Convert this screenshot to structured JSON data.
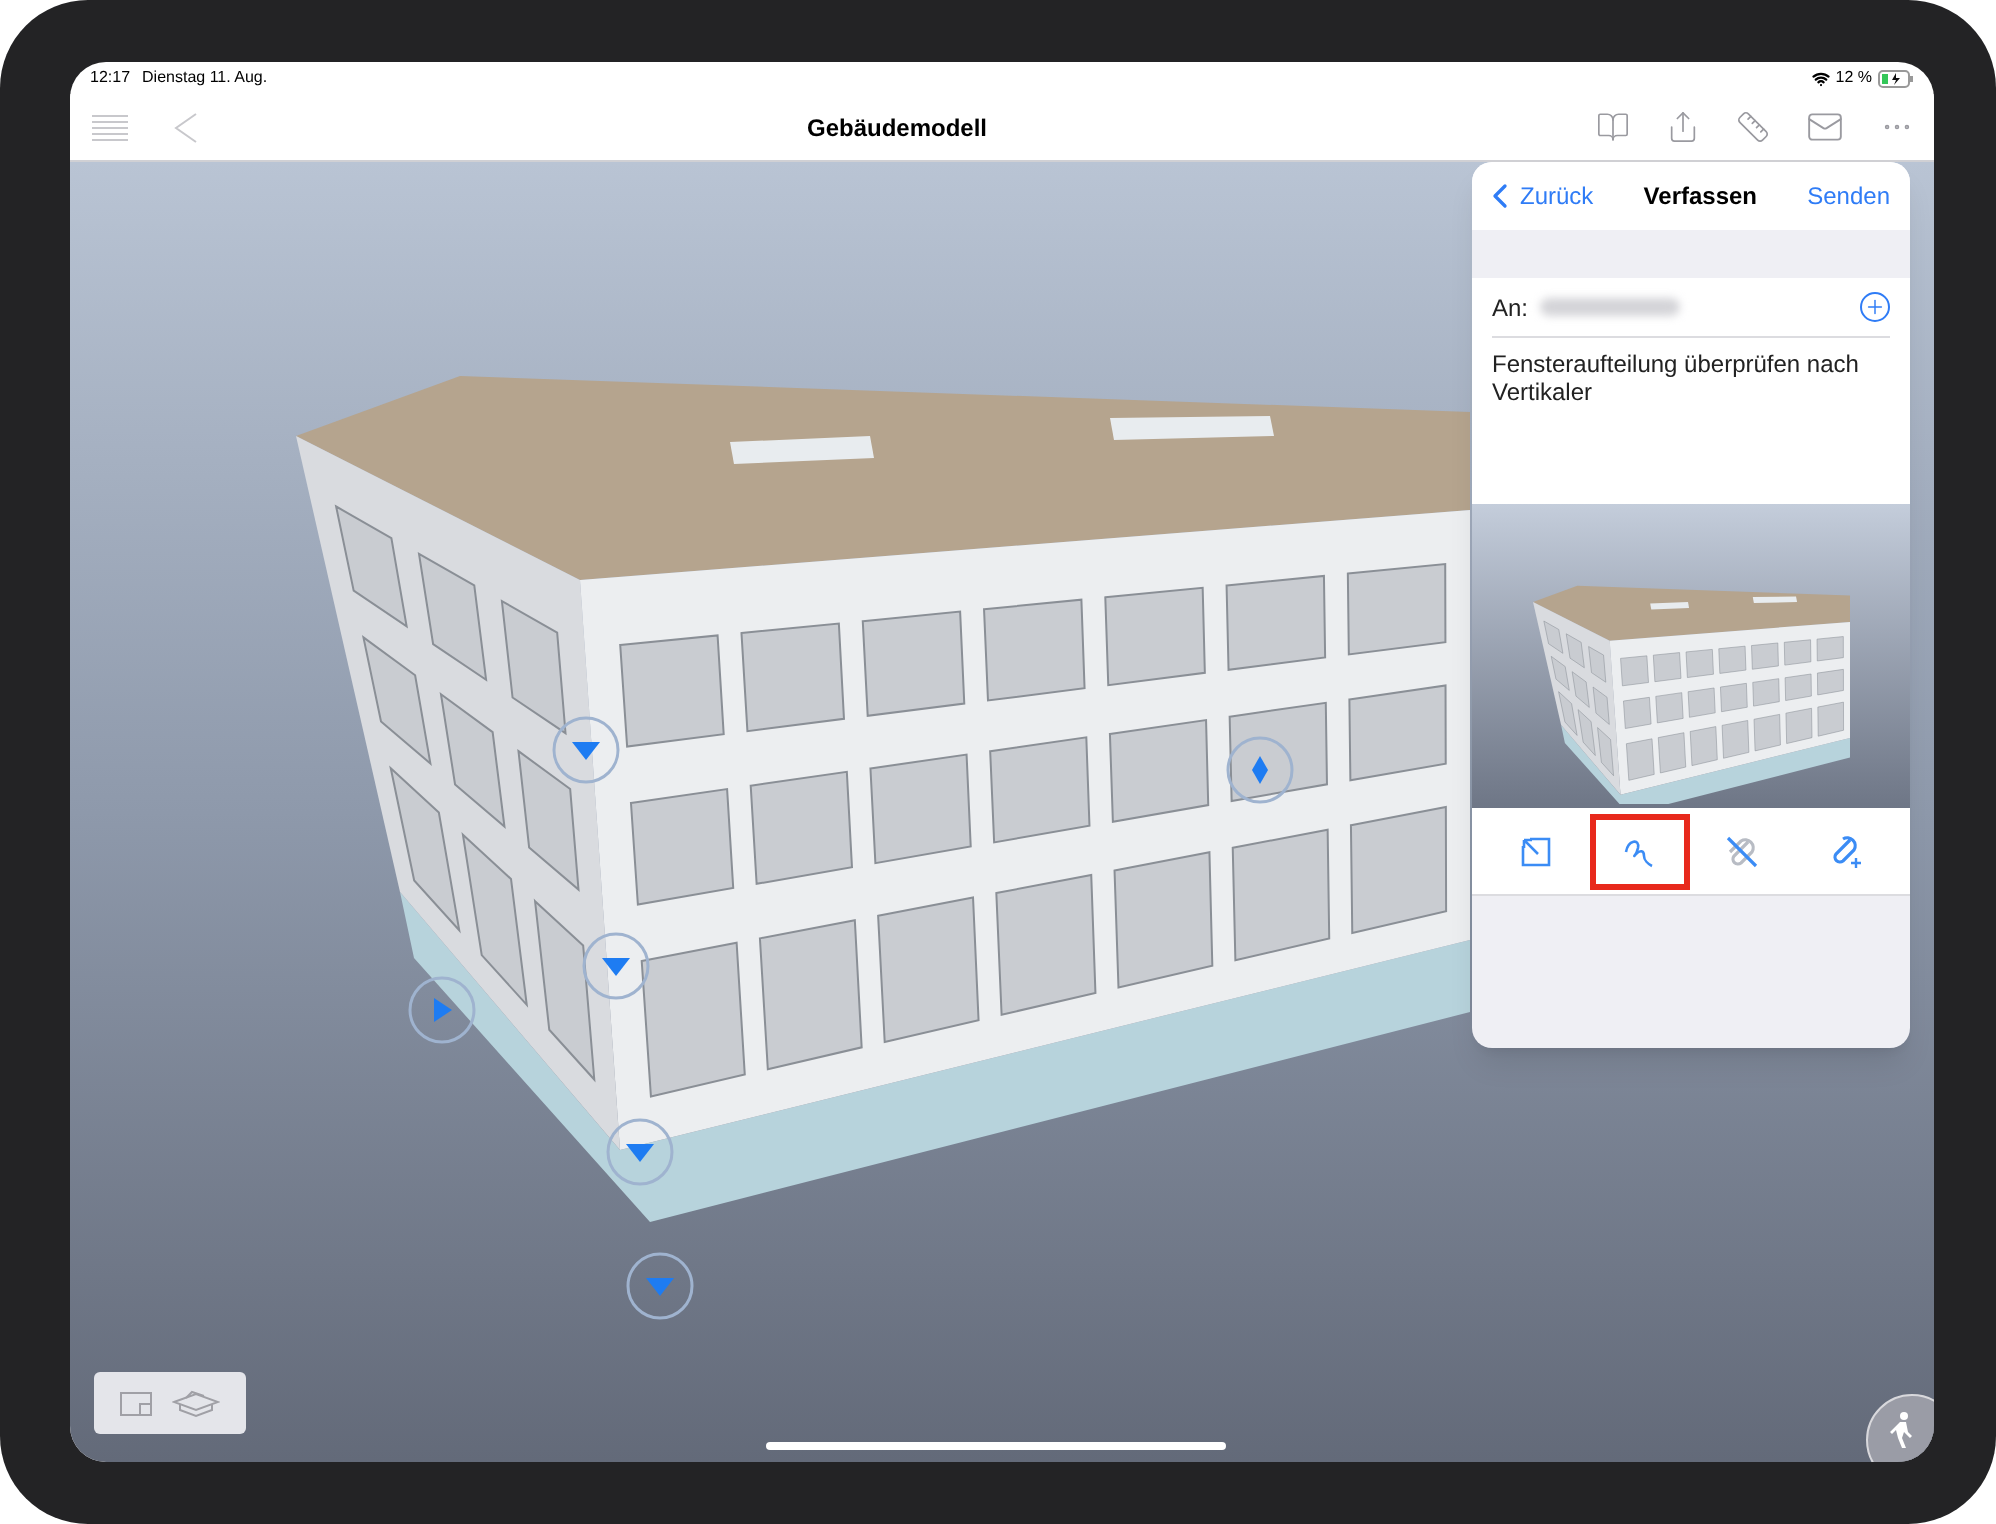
{
  "status_bar": {
    "time": "12:17",
    "date": "Dienstag 11. Aug.",
    "battery": "12 %"
  },
  "nav_bar": {
    "title": "Gebäudemodell"
  },
  "compose_panel": {
    "back": "Zurück",
    "title": "Verfassen",
    "send": "Senden",
    "to_label": "An:",
    "message": "Fensteraufteilung überprüfen nach Vertikaler",
    "tools": [
      {
        "kind": "resize",
        "selected": false
      },
      {
        "kind": "draw",
        "selected": true
      },
      {
        "kind": "remove",
        "selected": false
      },
      {
        "kind": "attach",
        "selected": false
      }
    ]
  }
}
